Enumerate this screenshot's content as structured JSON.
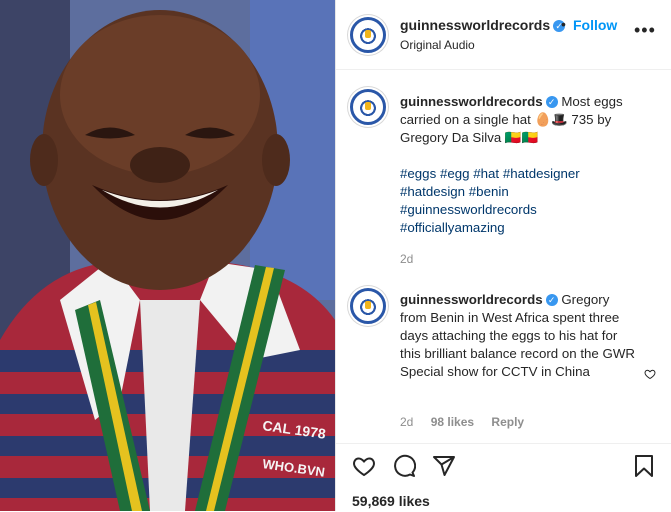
{
  "header": {
    "username": "guinnessworldrecords",
    "separator": "•",
    "follow_label": "Follow",
    "audio_label": "Original Audio",
    "more_label": "•••"
  },
  "caption": {
    "username": "guinnessworldrecords",
    "text": "Most eggs carried on a single hat 🥚🎩 735 by Gregory Da Silva 🇧🇯🇧🇯",
    "hashtags": [
      "#eggs",
      "#egg",
      "#hat",
      "#hatdesigner",
      "#hatdesign",
      "#benin",
      "#guinnessworldrecords",
      "#officiallyamazing"
    ],
    "time": "2d"
  },
  "comment": {
    "username": "guinnessworldrecords",
    "text": "Gregory from Benin in West Africa spent three days attaching the eggs to his hat for this brilliant balance record on the GWR Special show for CCTV in China",
    "time": "2d",
    "likes": "98 likes",
    "reply_label": "Reply"
  },
  "media": {
    "shirt_text_1": "CAL 1978",
    "shirt_text_2": "WHO.BVN"
  },
  "footer": {
    "likes": "59,869 likes"
  },
  "colors": {
    "follow": "#0095f6",
    "verified": "#3897f0",
    "hashtag": "#00376b",
    "muted": "#8e8e8e"
  }
}
